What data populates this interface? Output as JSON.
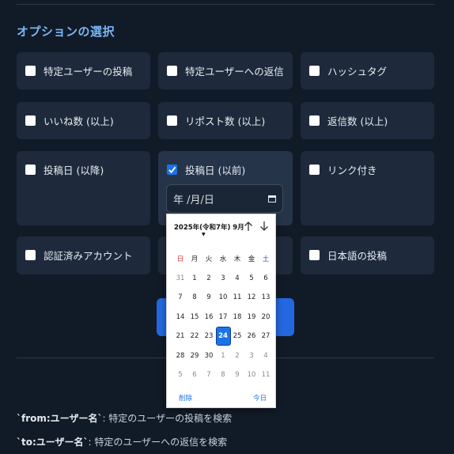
{
  "section_title": "オプションの選択",
  "options": [
    {
      "label": "特定ユーザーの投稿",
      "checked": false
    },
    {
      "label": "特定ユーザーへの返信",
      "checked": false
    },
    {
      "label": "ハッシュタグ",
      "checked": false
    },
    {
      "label": "いいね数 (以上)",
      "checked": false
    },
    {
      "label": "リポスト数 (以上)",
      "checked": false
    },
    {
      "label": "返信数 (以上)",
      "checked": false
    },
    {
      "label": "投稿日 (以降)",
      "checked": false
    },
    {
      "label": "投稿日 (以前)",
      "checked": true
    },
    {
      "label": "リンク付き",
      "checked": false
    },
    {
      "label": "認証済みアカウント",
      "checked": false
    },
    {
      "label": "日本語の投稿",
      "checked": false
    }
  ],
  "date_input": {
    "value": "年 /月/日"
  },
  "calendar": {
    "month_label": "2025年(令和7年) 9月",
    "weekdays": [
      "日",
      "月",
      "火",
      "水",
      "木",
      "金",
      "土"
    ],
    "weeks": [
      [
        "31",
        "1",
        "2",
        "3",
        "4",
        "5",
        "6"
      ],
      [
        "7",
        "8",
        "9",
        "10",
        "11",
        "12",
        "13"
      ],
      [
        "14",
        "15",
        "16",
        "17",
        "18",
        "19",
        "20"
      ],
      [
        "21",
        "22",
        "23",
        "24",
        "25",
        "26",
        "27"
      ],
      [
        "28",
        "29",
        "30",
        "1",
        "2",
        "3",
        "4"
      ],
      [
        "5",
        "6",
        "7",
        "8",
        "9",
        "10",
        "11"
      ]
    ],
    "today": "24",
    "clear_label": "削除",
    "today_label": "今日"
  },
  "help": [
    {
      "code": "`from:ユーザー名`",
      "text": ": 特定のユーザーの投稿を検索"
    },
    {
      "code": "`to:ユーザー名`",
      "text": ": 特定のユーザーへの返信を検索"
    }
  ],
  "colors": {
    "accent": "#1a73e8",
    "background": "#111a27",
    "card": "#1e2a3b",
    "title": "#7ab6f5"
  }
}
